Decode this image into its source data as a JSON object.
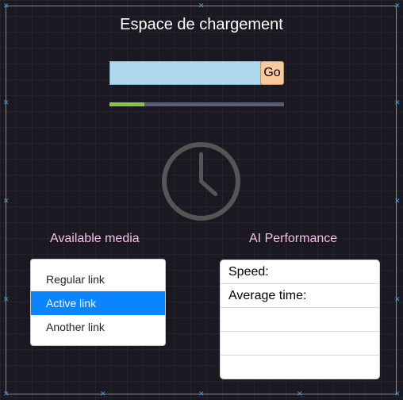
{
  "page": {
    "title": "Espace de chargement"
  },
  "search": {
    "value": "",
    "placeholder": "",
    "button_label": "Go"
  },
  "progress": {
    "fraction": 0.2,
    "fill_color": "#8bc34a",
    "track_color": "#566073"
  },
  "clock": {
    "icon": "clock-icon"
  },
  "media": {
    "label": "Available media",
    "links": [
      {
        "label": "Regular link",
        "active": false
      },
      {
        "label": "Active link",
        "active": true
      },
      {
        "label": "Another link",
        "active": false
      }
    ]
  },
  "performance": {
    "label": "AI Performance",
    "rows": [
      "Speed:",
      "Average time:",
      "",
      "",
      ""
    ]
  },
  "colors": {
    "background": "#1a1820",
    "accent": "#0a84ff",
    "section_label": "#f2c0e6",
    "input_bg": "#add8ee",
    "button_bg": "#f8c99c"
  }
}
